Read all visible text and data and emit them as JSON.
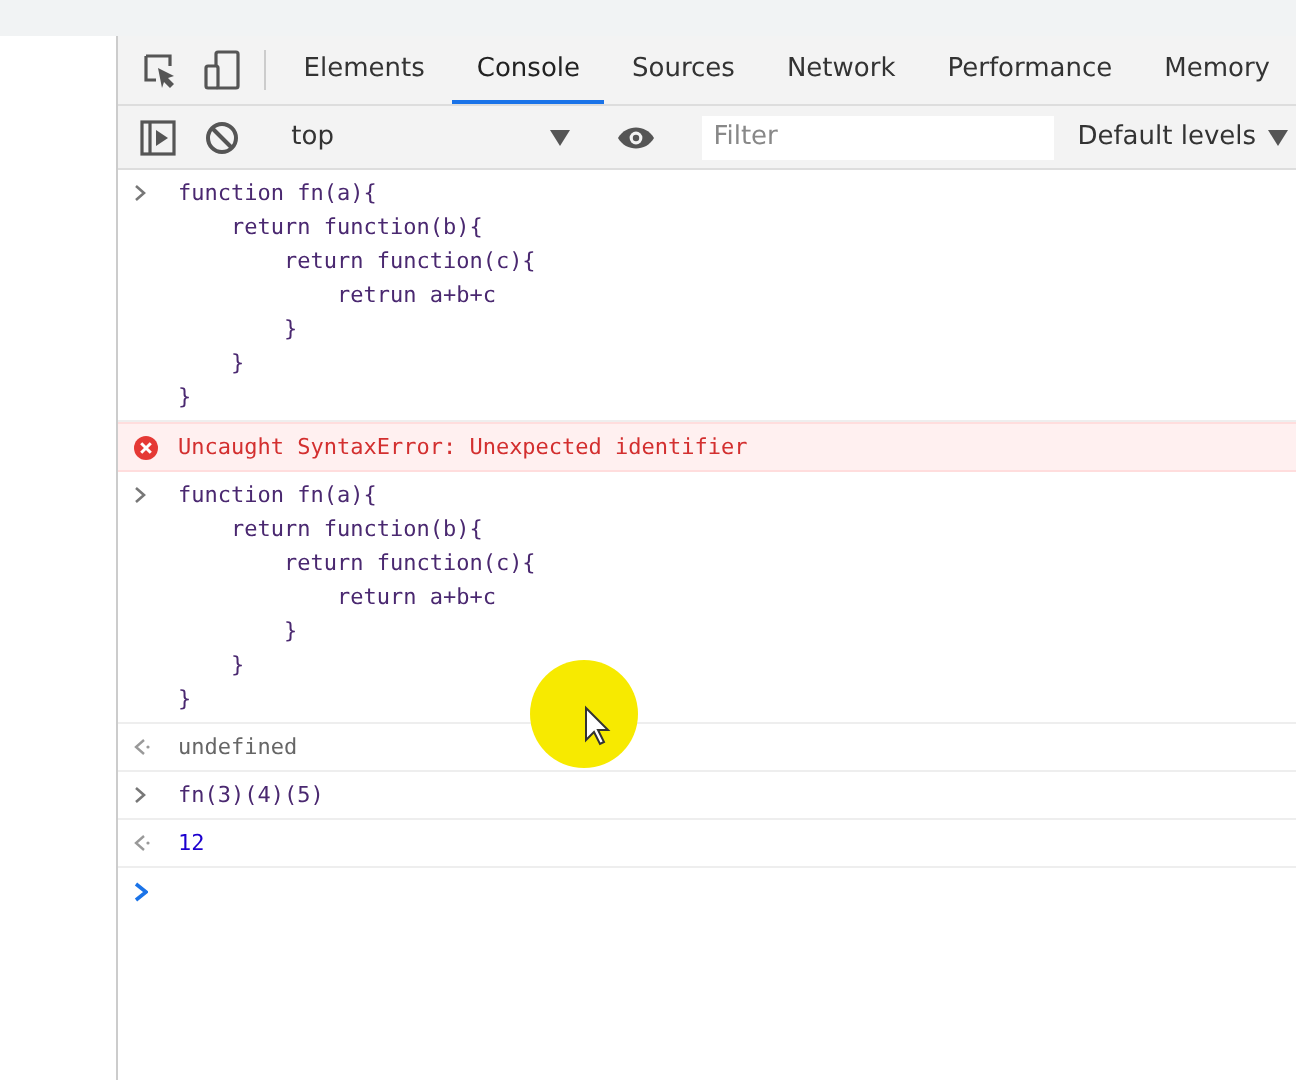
{
  "tabs": [
    {
      "label": "Elements",
      "selected": false
    },
    {
      "label": "Console",
      "selected": true
    },
    {
      "label": "Sources",
      "selected": false
    },
    {
      "label": "Network",
      "selected": false
    },
    {
      "label": "Performance",
      "selected": false
    },
    {
      "label": "Memory",
      "selected": false
    }
  ],
  "toolbar": {
    "context": "top",
    "filter": {
      "placeholder": "Filter"
    },
    "levels": "Default levels"
  },
  "console": [
    {
      "kind": "input",
      "text": "function fn(a){\n    return function(b){\n        return function(c){\n            retrun a+b+c\n        }\n    }\n}"
    },
    {
      "kind": "error",
      "text": "Uncaught SyntaxError: Unexpected identifier"
    },
    {
      "kind": "input",
      "text": "function fn(a){\n    return function(b){\n        return function(c){\n            return a+b+c\n        }\n    }\n}"
    },
    {
      "kind": "output",
      "text": "undefined"
    },
    {
      "kind": "input",
      "text": "fn(3)(4)(5)"
    },
    {
      "kind": "output",
      "text": "12"
    },
    {
      "kind": "prompt"
    }
  ]
}
